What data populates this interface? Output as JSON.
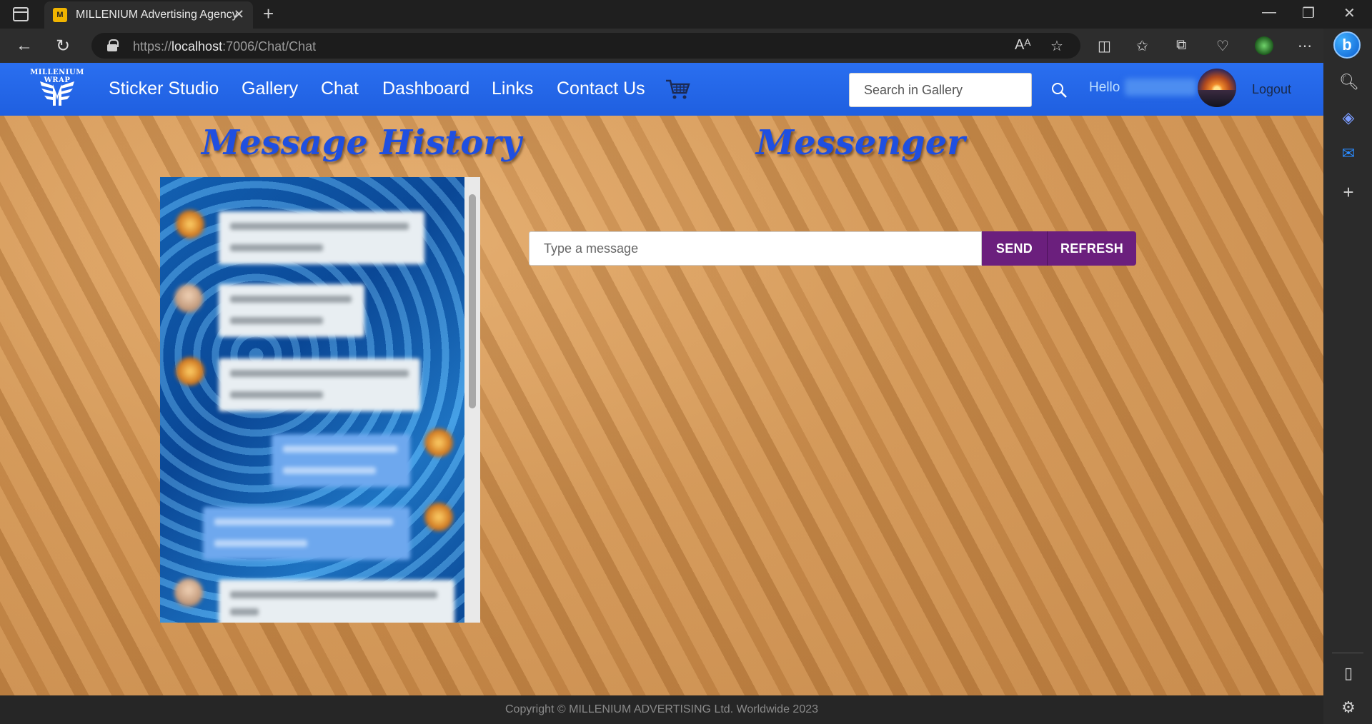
{
  "browser": {
    "tab_title": "MILLENIUM Advertising Agency",
    "tab_favicon": "logo-favicon",
    "url_prefix": "https://",
    "url_host": "localhost",
    "url_path": ":7006/Chat/Chat"
  },
  "navbar": {
    "logo_text": "MILLENIUM WRAP",
    "links": [
      "Sticker Studio",
      "Gallery",
      "Chat",
      "Dashboard",
      "Links",
      "Contact Us"
    ],
    "search_placeholder": "Search in Gallery",
    "hello_label": "Hello",
    "logout_label": "Logout",
    "accent_color": "#1f5fe0"
  },
  "main": {
    "history_heading": "Message History",
    "messenger_heading": "Messenger",
    "message_placeholder": "Type a message",
    "send_label": "SEND",
    "refresh_label": "REFRESH",
    "button_color": "#6b1f7d"
  },
  "footer": {
    "copyright": "Copyright © MILLENIUM ADVERTISING Ltd. Worldwide 2023"
  }
}
